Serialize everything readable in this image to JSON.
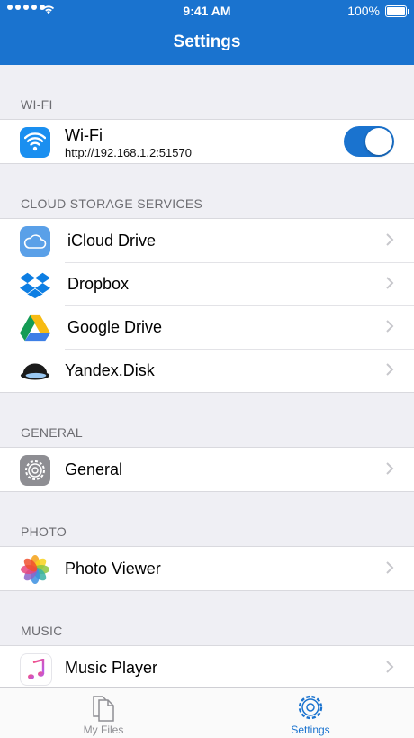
{
  "status_bar": {
    "time": "9:41 AM",
    "battery": "100%"
  },
  "nav": {
    "title": "Settings"
  },
  "sections": {
    "wifi": {
      "header": "WI-FI",
      "item": {
        "label": "Wi-Fi",
        "address": "http://192.168.1.2:51570",
        "enabled": true,
        "icon": "wifi-icon"
      }
    },
    "cloud": {
      "header": "CLOUD STORAGE SERVICES",
      "items": [
        {
          "label": "iCloud Drive",
          "icon": "icloud-icon"
        },
        {
          "label": "Dropbox",
          "icon": "dropbox-icon"
        },
        {
          "label": "Google Drive",
          "icon": "google-drive-icon"
        },
        {
          "label": "Yandex.Disk",
          "icon": "yandex-disk-icon"
        }
      ]
    },
    "general": {
      "header": "GENERAL",
      "item": {
        "label": "General",
        "icon": "gear-icon"
      }
    },
    "photo": {
      "header": "PHOTO",
      "item": {
        "label": "Photo Viewer",
        "icon": "photos-icon"
      }
    },
    "music": {
      "header": "MUSIC",
      "item": {
        "label": "Music Player",
        "icon": "music-note-icon"
      }
    }
  },
  "tabbar": {
    "tabs": [
      {
        "label": "My Files",
        "icon": "files-icon",
        "selected": false
      },
      {
        "label": "Settings",
        "icon": "gear-icon",
        "selected": true
      }
    ]
  },
  "colors": {
    "accent": "#1a73cf",
    "background": "#efeff4"
  }
}
